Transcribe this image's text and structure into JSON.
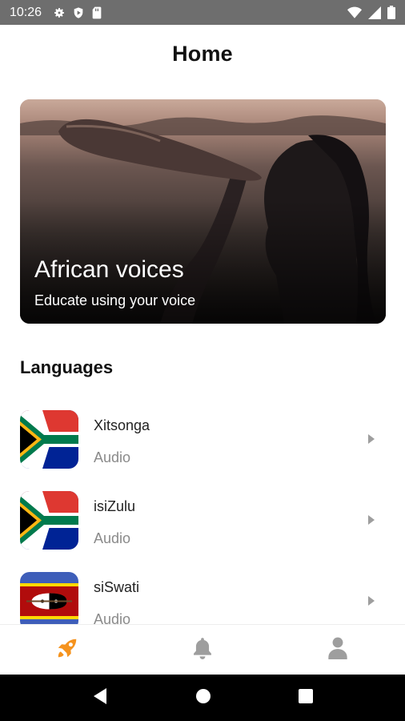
{
  "status_bar": {
    "time": "10:26",
    "left_icons": [
      "gear-icon",
      "shield-play-icon",
      "sd-card-icon"
    ],
    "right_icons": [
      "wifi-icon",
      "signal-icon",
      "battery-icon"
    ]
  },
  "header": {
    "title": "Home"
  },
  "hero": {
    "title": "African voices",
    "subtitle": "Educate using your voice"
  },
  "languages": {
    "section_title": "Languages",
    "items": [
      {
        "name": "Xitsonga",
        "type": "Audio",
        "flag": "south-africa"
      },
      {
        "name": "isiZulu",
        "type": "Audio",
        "flag": "south-africa"
      },
      {
        "name": "siSwati",
        "type": "Audio",
        "flag": "eswatini"
      }
    ]
  },
  "bottom_nav": {
    "tabs": [
      {
        "icon": "rocket-icon",
        "active": true
      },
      {
        "icon": "bell-icon",
        "active": false
      },
      {
        "icon": "user-icon",
        "active": false
      }
    ],
    "active_color": "#f5931e",
    "inactive_color": "#9e9e9e"
  },
  "system_nav": {
    "buttons": [
      "back-icon",
      "home-icon",
      "recents-icon"
    ]
  }
}
